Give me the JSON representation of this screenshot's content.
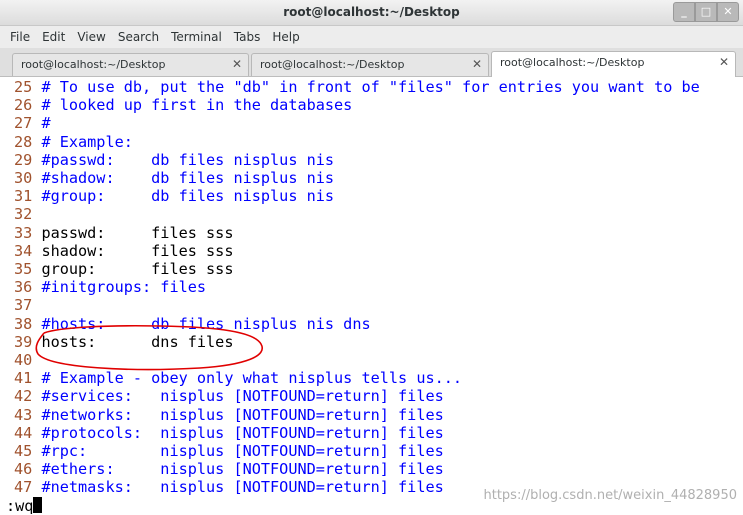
{
  "window": {
    "title": "root@localhost:~/Desktop",
    "buttons": [
      "_",
      "□",
      "✕"
    ]
  },
  "menu": [
    "File",
    "Edit",
    "View",
    "Search",
    "Terminal",
    "Tabs",
    "Help"
  ],
  "tabs": [
    {
      "label": "root@localhost:~/Desktop",
      "close": "✕"
    },
    {
      "label": "root@localhost:~/Desktop",
      "close": "✕"
    },
    {
      "label": "root@localhost:~/Desktop",
      "close": "✕"
    }
  ],
  "editor": {
    "lines": [
      {
        "n": "25",
        "text": " # To use db, put the \"db\" in front of \"files\" for entries you want to be",
        "comment": true
      },
      {
        "n": "26",
        "text": " # looked up first in the databases",
        "comment": true
      },
      {
        "n": "27",
        "text": " #",
        "comment": true
      },
      {
        "n": "28",
        "text": " # Example:",
        "comment": true
      },
      {
        "n": "29",
        "text": " #passwd:    db files nisplus nis",
        "comment": true
      },
      {
        "n": "30",
        "text": " #shadow:    db files nisplus nis",
        "comment": true
      },
      {
        "n": "31",
        "text": " #group:     db files nisplus nis",
        "comment": true
      },
      {
        "n": "32",
        "text": "",
        "comment": false
      },
      {
        "n": "33",
        "text": " passwd:     files sss",
        "comment": false
      },
      {
        "n": "34",
        "text": " shadow:     files sss",
        "comment": false
      },
      {
        "n": "35",
        "text": " group:      files sss",
        "comment": false
      },
      {
        "n": "36",
        "text": " #initgroups: files",
        "comment": true
      },
      {
        "n": "37",
        "text": "",
        "comment": false
      },
      {
        "n": "38",
        "text": " #hosts:     db files nisplus nis dns",
        "comment": true
      },
      {
        "n": "39",
        "text": " hosts:      dns files",
        "comment": false
      },
      {
        "n": "40",
        "text": "",
        "comment": false
      },
      {
        "n": "41",
        "text": " # Example - obey only what nisplus tells us...",
        "comment": true
      },
      {
        "n": "42",
        "text": " #services:   nisplus [NOTFOUND=return] files",
        "comment": true
      },
      {
        "n": "43",
        "text": " #networks:   nisplus [NOTFOUND=return] files",
        "comment": true
      },
      {
        "n": "44",
        "text": " #protocols:  nisplus [NOTFOUND=return] files",
        "comment": true
      },
      {
        "n": "45",
        "text": " #rpc:        nisplus [NOTFOUND=return] files",
        "comment": true
      },
      {
        "n": "46",
        "text": " #ethers:     nisplus [NOTFOUND=return] files",
        "comment": true
      },
      {
        "n": "47",
        "text": " #netmasks:   nisplus [NOTFOUND=return] files",
        "comment": true
      }
    ],
    "command": ":wq"
  },
  "watermark": "https://blog.csdn.net/weixin_44828950",
  "colors": {
    "line_number": "#a0522d",
    "comment": "#0000ff",
    "annotation": "#e00000"
  }
}
